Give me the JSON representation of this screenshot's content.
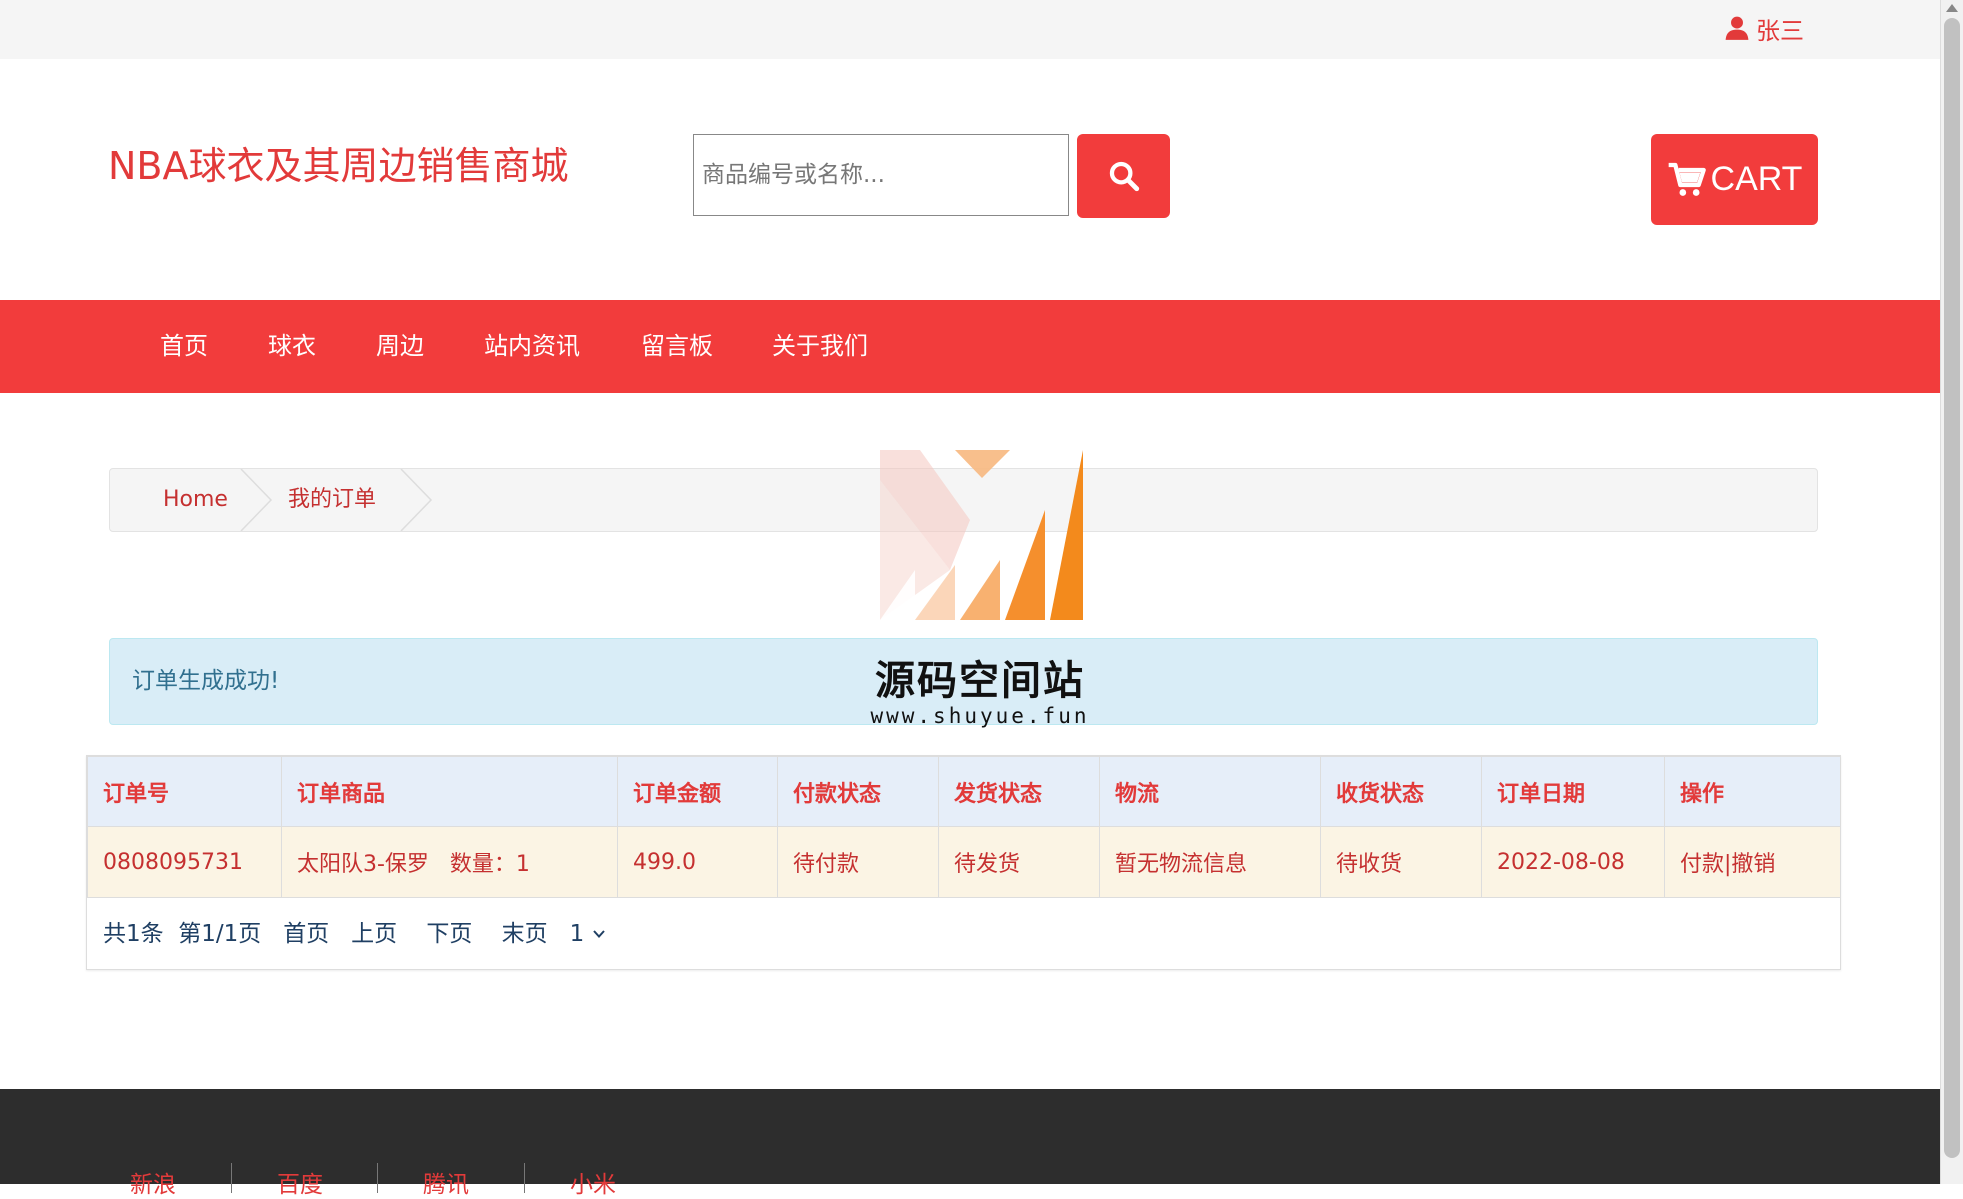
{
  "topbar": {
    "user_name": "张三",
    "user_icon": "user-icon"
  },
  "header": {
    "site_title": "NBA球衣及其周边销售商城",
    "search_placeholder": "商品编号或名称...",
    "search_icon": "search-icon",
    "cart_label": "CART",
    "cart_icon": "cart-icon",
    "accent_color": "#f23c3c"
  },
  "nav": {
    "items": [
      {
        "label": "首页"
      },
      {
        "label": "球衣"
      },
      {
        "label": "周边"
      },
      {
        "label": "站内资讯"
      },
      {
        "label": "留言板"
      },
      {
        "label": "关于我们"
      }
    ]
  },
  "breadcrumb": {
    "items": [
      {
        "label": "Home"
      },
      {
        "label": "我的订单"
      }
    ]
  },
  "watermark": {
    "text": "源码空间站",
    "url": "www.shuyue.fun"
  },
  "alert": {
    "message": "订单生成成功!"
  },
  "orders": {
    "columns": [
      "订单号",
      "订单商品",
      "订单金额",
      "付款状态",
      "发货状态",
      "物流",
      "收货状态",
      "订单日期",
      "操作"
    ],
    "rows": [
      {
        "order_no": "0808095731",
        "product": "太阳队3-保罗",
        "quantity": "数量：1",
        "amount": "499.0",
        "pay_status": "待付款",
        "ship_status": "待发货",
        "logistics": "暂无物流信息",
        "receive_status": "待收货",
        "date": "2022-08-08",
        "action_pay": "付款|",
        "action_cancel": "撤销"
      }
    ],
    "pager": {
      "total": "共1条",
      "page_info": "第1/1页",
      "first": "首页",
      "prev": "上页",
      "next": "下页",
      "last": "末页",
      "page_select": "1"
    }
  },
  "footer": {
    "links": [
      {
        "label": "新浪"
      },
      {
        "label": "百度"
      },
      {
        "label": "腾讯"
      },
      {
        "label": "小米"
      }
    ]
  }
}
